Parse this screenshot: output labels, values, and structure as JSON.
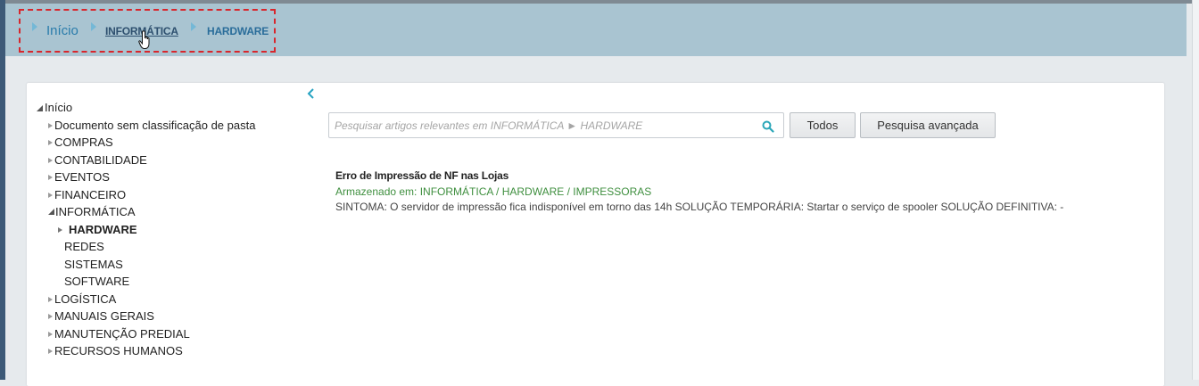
{
  "breadcrumb": {
    "items": [
      {
        "label": "Início"
      },
      {
        "label": "INFORMÁTICA"
      },
      {
        "label": "HARDWARE"
      }
    ]
  },
  "tree": {
    "root": "Início",
    "items": [
      {
        "label": "Documento sem classificação de pasta",
        "expander": "collapsed"
      },
      {
        "label": "COMPRAS",
        "expander": "collapsed"
      },
      {
        "label": "CONTABILIDADE",
        "expander": "collapsed"
      },
      {
        "label": "EVENTOS",
        "expander": "collapsed"
      },
      {
        "label": "FINANCEIRO",
        "expander": "collapsed"
      },
      {
        "label": "INFORMÁTICA",
        "expander": "expanded"
      },
      {
        "label": "HARDWARE",
        "expander": "collapsed",
        "selected": true
      },
      {
        "label": "REDES"
      },
      {
        "label": "SISTEMAS"
      },
      {
        "label": "SOFTWARE"
      },
      {
        "label": "LOGÍSTICA",
        "expander": "collapsed"
      },
      {
        "label": "MANUAIS GERAIS",
        "expander": "collapsed"
      },
      {
        "label": "MANUTENÇÃO PREDIAL",
        "expander": "collapsed"
      },
      {
        "label": "RECURSOS HUMANOS",
        "expander": "collapsed"
      }
    ]
  },
  "search": {
    "value": "",
    "placeholder": "Pesquisar artigos relevantes em INFORMÁTICA ► HARDWARE",
    "todos_label": "Todos",
    "advanced_label": "Pesquisa avançada"
  },
  "results": [
    {
      "title": "Erro de Impressão de NF nas Lojas",
      "location": "Armazenado em: INFORMÁTICA / HARDWARE / IMPRESSORAS",
      "snippet": "SINTOMA: O servidor de impressão fica indisponível em torno das 14h SOLUÇÃO TEMPORÁRIA: Startar o serviço de spooler SOLUÇÃO DEFINITIVA: -"
    }
  ],
  "colors": {
    "breadcrumb_bar": "#a9c4d1",
    "link": "#2a7cab",
    "highlight_frame": "#d8262c",
    "location_green": "#3f8f3f"
  },
  "icons": [
    "chevron-right-icon",
    "hand-cursor-icon",
    "chevron-left-icon",
    "search-icon",
    "triangle-right-icon",
    "triangle-down-icon"
  ]
}
